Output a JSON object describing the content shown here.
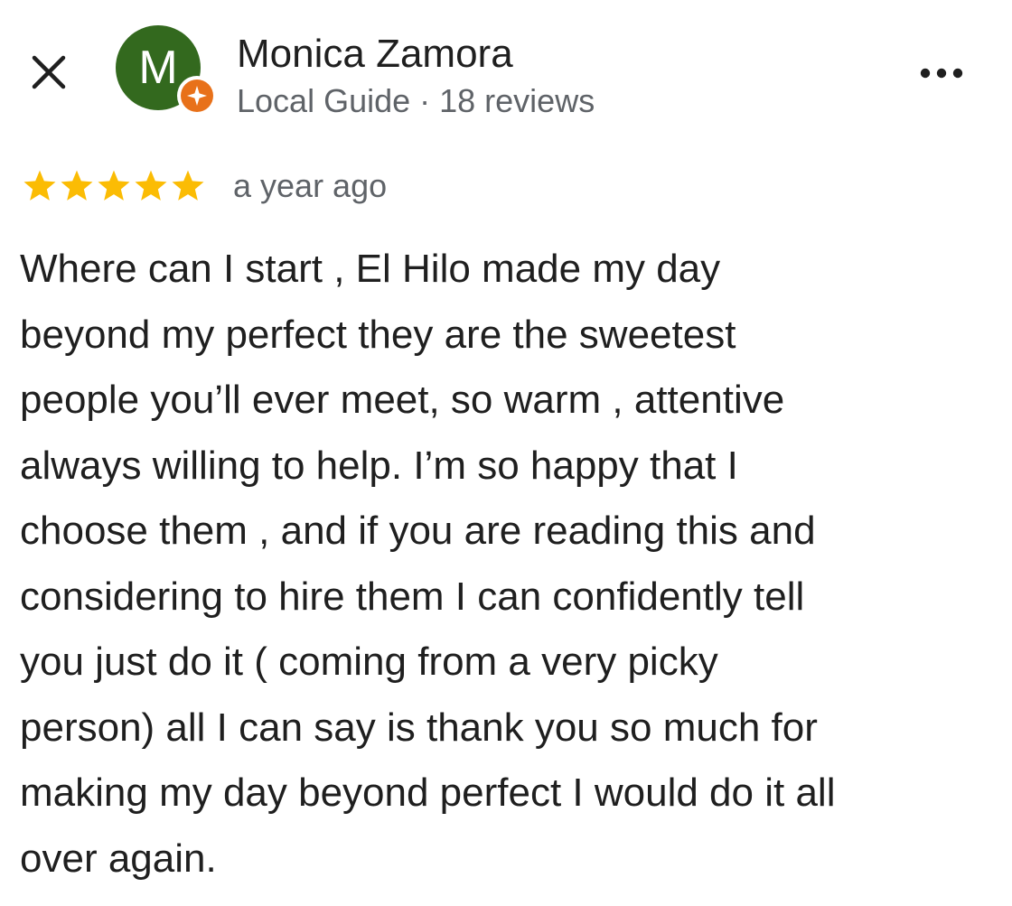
{
  "header": {
    "avatar_initial": "M",
    "user_name": "Monica Zamora",
    "user_meta": "Local Guide · 18 reviews"
  },
  "rating": {
    "stars": 5,
    "max_stars": 5,
    "timestamp": "a year ago"
  },
  "review": {
    "lines": [
      "Where can I start , El Hilo made my day",
      "beyond my perfect they are the sweetest",
      "people you’ll ever meet, so warm , attentive",
      "always willing to help. I’m so happy that I",
      "choose them , and if you are reading this and",
      "considering to hire them I can confidently tell",
      "you just do it ( coming from a very picky",
      "person) all I can say is thank you so much for",
      "making my day beyond perfect I would do it all",
      "over again."
    ]
  },
  "icons": {
    "close": "close-icon",
    "more": "more-options-icon",
    "badge": "local-guide-badge-icon",
    "star": "star-icon"
  },
  "colors": {
    "avatar_bg": "#33691e",
    "badge": "#e8711a",
    "star": "#fbbc04",
    "secondary_text": "#5f6368",
    "primary_text": "#1f1f1f"
  }
}
